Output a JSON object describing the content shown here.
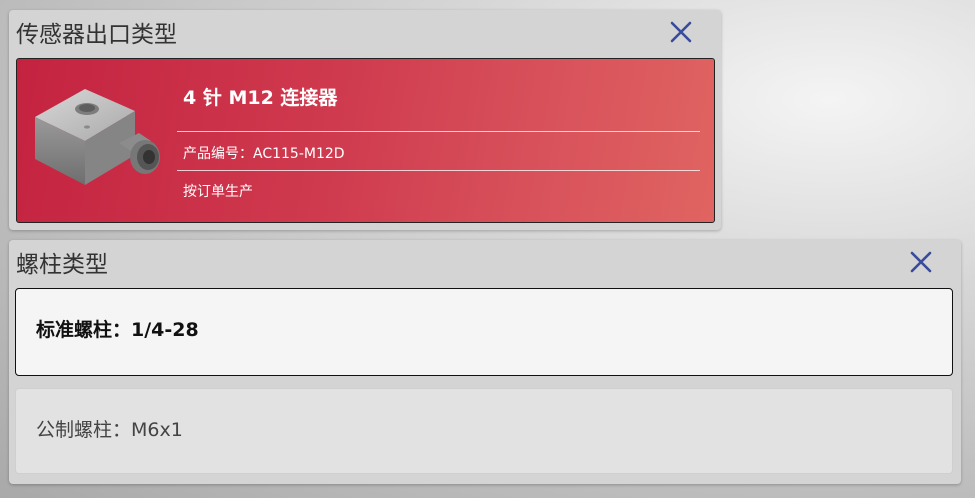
{
  "sensor_output": {
    "title": "传感器出口类型",
    "selected": {
      "name": "4 针 M12 连接器",
      "part_number": "产品编号：AC115-M12D",
      "availability": "按订单生产"
    },
    "colors": {
      "card_start": "#c42340",
      "card_end": "#e06461"
    }
  },
  "stud_type": {
    "title": "螺柱类型",
    "options": [
      {
        "label": "标准螺柱：1/4-28",
        "selected": true
      },
      {
        "label": "公制螺柱：M6x1",
        "selected": false
      }
    ]
  },
  "icons": {
    "close": "close-icon",
    "product": "sensor-product-image"
  },
  "accent": "#3a4a9c"
}
